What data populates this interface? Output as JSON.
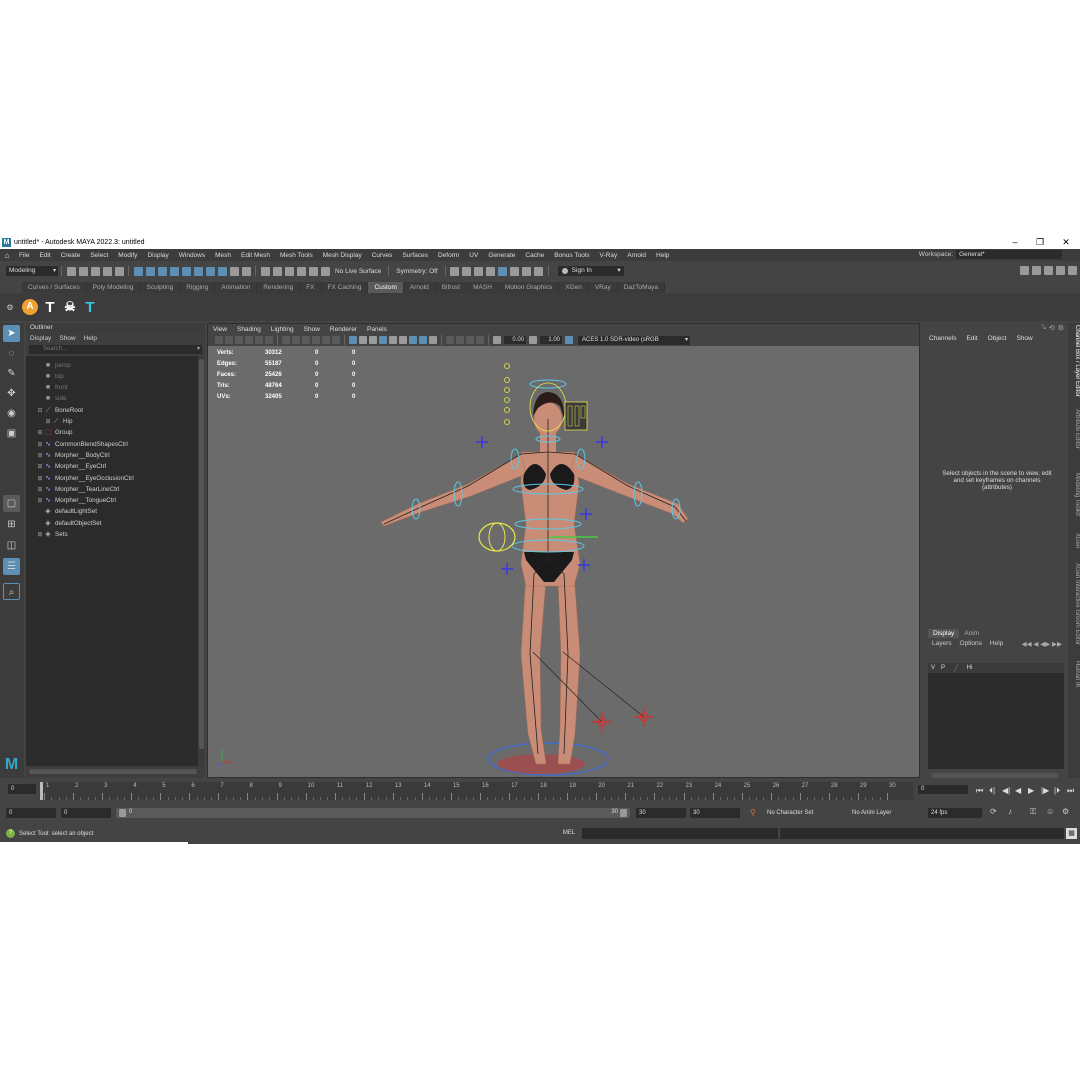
{
  "window": {
    "title": "untitled* - Autodesk MAYA 2022.3: untitled",
    "logo": "M",
    "controls": [
      "–",
      "❐",
      "✕"
    ]
  },
  "menubar": {
    "items": [
      "File",
      "Edit",
      "Create",
      "Select",
      "Modify",
      "Display",
      "Windows",
      "Mesh",
      "Edit Mesh",
      "Mesh Tools",
      "Mesh Display",
      "Curves",
      "Surfaces",
      "Deform",
      "UV",
      "Generate",
      "Cache",
      "Bonus Tools",
      "V-Ray",
      "Arnold",
      "Help"
    ],
    "workspace_label": "Workspace:",
    "workspace_value": "General*"
  },
  "statusline": {
    "mode": "Modeling",
    "live_surface": "No Live Surface",
    "symmetry": "Symmetry: Off",
    "sign_in": "Sign In"
  },
  "shelf": {
    "tabs": [
      "Curves / Surfaces",
      "Poly Modeling",
      "Sculpting",
      "Rigging",
      "Animation",
      "Rendering",
      "FX",
      "FX Caching",
      "Custom",
      "Arnold",
      "Bifrost",
      "MASH",
      "Motion Graphics",
      "XGen",
      "VRay",
      "DazToMaya"
    ],
    "active_tab": "Custom",
    "icons": [
      {
        "name": "orange-a-icon",
        "glyph": "A",
        "color": "#f0a030"
      },
      {
        "name": "t-pose-white-icon",
        "glyph": "T",
        "color": "#ffffff"
      },
      {
        "name": "skull-icon",
        "glyph": "☠",
        "color": "#ffffff"
      },
      {
        "name": "t-pose-cyan-icon",
        "glyph": "T",
        "color": "#33c6e0"
      }
    ]
  },
  "outliner": {
    "title": "Outliner",
    "menu": [
      "Display",
      "Show",
      "Help"
    ],
    "search_placeholder": "Search...",
    "items": [
      {
        "label": "persp",
        "dim": true,
        "expand": "",
        "icon": "camera"
      },
      {
        "label": "top",
        "dim": true,
        "expand": "",
        "icon": "camera"
      },
      {
        "label": "front",
        "dim": true,
        "expand": "",
        "icon": "camera"
      },
      {
        "label": "side",
        "dim": true,
        "expand": "",
        "icon": "camera"
      },
      {
        "label": "BoneRoot",
        "dim": false,
        "expand": "⊟",
        "icon": "joint"
      },
      {
        "label": "Hip",
        "dim": false,
        "expand": "⊞",
        "icon": "joint",
        "indent": 1
      },
      {
        "label": "Group",
        "dim": false,
        "expand": "⊞",
        "icon": "group"
      },
      {
        "label": "CommonBlendShapesCtrl",
        "dim": false,
        "expand": "⊞",
        "icon": "curve"
      },
      {
        "label": "Morpher__BodyCtrl",
        "dim": false,
        "expand": "⊞",
        "icon": "curve"
      },
      {
        "label": "Morpher__EyeCtrl",
        "dim": false,
        "expand": "⊞",
        "icon": "curve"
      },
      {
        "label": "Morpher__EyeOcclusionCtrl",
        "dim": false,
        "expand": "⊞",
        "icon": "curve"
      },
      {
        "label": "Morpher__TearLineCtrl",
        "dim": false,
        "expand": "⊞",
        "icon": "curve"
      },
      {
        "label": "Morpher__TongueCtrl",
        "dim": false,
        "expand": "⊞",
        "icon": "curve"
      },
      {
        "label": "defaultLightSet",
        "dim": false,
        "expand": "",
        "icon": "set"
      },
      {
        "label": "defaultObjectSet",
        "dim": false,
        "expand": "",
        "icon": "set"
      },
      {
        "label": "Sets",
        "dim": false,
        "expand": "⊞",
        "icon": "set"
      }
    ]
  },
  "viewport": {
    "menu": [
      "View",
      "Shading",
      "Lighting",
      "Show",
      "Renderer",
      "Panels"
    ],
    "exposure": "0.00",
    "gamma": "1.00",
    "color_space": "ACES 1.0 SDR-video (sRGB",
    "hud": [
      {
        "label": "Verts:",
        "v1": "30312",
        "v2": "0",
        "v3": "0"
      },
      {
        "label": "Edges:",
        "v1": "55187",
        "v2": "0",
        "v3": "0"
      },
      {
        "label": "Faces:",
        "v1": "25426",
        "v2": "0",
        "v3": "0"
      },
      {
        "label": "Tris:",
        "v1": "48764",
        "v2": "0",
        "v3": "0"
      },
      {
        "label": "UVs:",
        "v1": "32405",
        "v2": "0",
        "v3": "0"
      }
    ],
    "colors": {
      "skin": "#c98d77",
      "skin_shade": "#a86d58",
      "rig_cyan": "#5cc8e6",
      "rig_yellow": "#e8e64a",
      "rig_blue": "#3a3ad8",
      "rig_red": "#d43030",
      "bikini": "#1a1a1a",
      "hair": "#2a1c18"
    }
  },
  "channelbox": {
    "menu": [
      "Channels",
      "Edit",
      "Object",
      "Show"
    ],
    "hint": "Select objects in the scene to view, edit and set keyframes on channels (attributes)"
  },
  "layers": {
    "tabs": [
      "Display",
      "Anim"
    ],
    "menu": [
      "Layers",
      "Options",
      "Help"
    ],
    "row": {
      "v": "V",
      "p": "P",
      "name": "Hi"
    }
  },
  "side_tabs": [
    "Channel Box / Layer Editor",
    "Attribute Editor",
    "Modeling Toolkit",
    "XGen",
    "XGen Interactive Groom Editor",
    "Human IK"
  ],
  "timeline": {
    "ticks": [
      "1",
      "2",
      "3",
      "4",
      "5",
      "6",
      "7",
      "8",
      "9",
      "10",
      "11",
      "12",
      "13",
      "14",
      "15",
      "16",
      "17",
      "18",
      "19",
      "20",
      "21",
      "22",
      "23",
      "24",
      "25",
      "26",
      "27",
      "28",
      "29",
      "30"
    ],
    "current_frame": "0",
    "left_frame": "0",
    "playback_buttons": [
      "⏮",
      "⏴|",
      "◀|",
      "◀",
      "▶",
      "|▶",
      "|⏵",
      "⏭"
    ]
  },
  "range": {
    "start": "0",
    "inner_start": "0",
    "slider_start": "0",
    "slider_end": "30",
    "end_a": "30",
    "end_b": "30",
    "character_set": "No Character Set",
    "anim_layer": "No Anim Layer",
    "fps": "24 fps"
  },
  "commandline": {
    "help": "Select Tool: select an object",
    "lang": "MEL"
  }
}
